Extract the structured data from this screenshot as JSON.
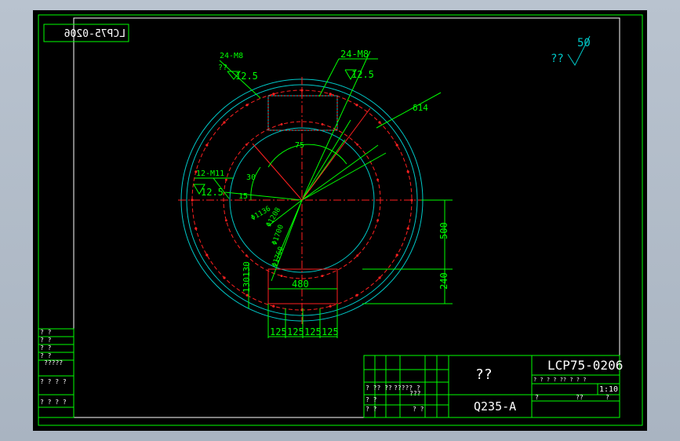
{
  "colors": {
    "background": "#000000",
    "frame": "#00ff00",
    "dimension": "#00ff00",
    "circle": "#00c8c8",
    "hidden": "#ff2020",
    "text_white": "#ffffff",
    "cyan_text": "#00c8c8",
    "window_bg": "#b9c3cf"
  },
  "drawing": {
    "mirrored_code": "LCP75-0206",
    "surface_finish_mark": "??",
    "surface_finish_value": "50",
    "callouts": {
      "top_left_label": "24-M8",
      "top_left_finish_label": "??",
      "top_left_roughness": "12.5",
      "top_center_label": "24-M8",
      "top_center_roughness": "12.5",
      "left_label": "12-M11",
      "left_roughness": "12.5",
      "thickness": "δ14"
    },
    "angles": {
      "a75": "75",
      "a30": "30",
      "a15": "15"
    },
    "diameters": {
      "d1136": "Φ1136",
      "d1208": "Φ1208",
      "d1700": "Φ1700",
      "d1760": "Φ1760"
    },
    "dims": {
      "width480": "480",
      "h500": "500",
      "h240": "240",
      "v130": "130",
      "v130b": "130",
      "bottom": [
        "125",
        "125",
        "125",
        "125"
      ]
    }
  },
  "title_block": {
    "part_name": "??",
    "material": "Q235-A",
    "drawing_number": "LCP75-0206",
    "scale": "1:10",
    "left_col_a": "? ??   ??",
    "left_col_b": "?????  ?",
    "left_col_c": "???",
    "left_col_d": "? ?",
    "left_col_e": "? ?",
    "left_col_f": "? ?",
    "row_small": "? ?  ?  ?  ??  ? ?  ?",
    "q1": "?",
    "q2": "??",
    "q3": "?",
    "sheet_row": "?     ?     ?     ??    ?   ? ?",
    "sheet_row_b": "?         ??         ?"
  },
  "side_block": {
    "rows": [
      "? ?",
      "? ?",
      "? ?",
      "? ?",
      "?????",
      "? ? ? ?",
      "? ? ?   ?"
    ]
  }
}
